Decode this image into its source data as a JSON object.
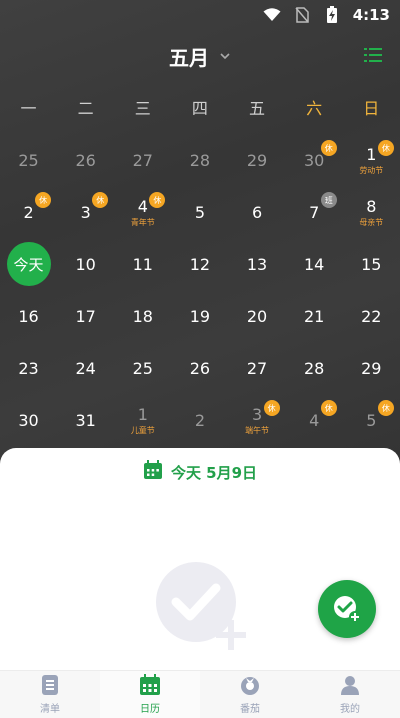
{
  "status_bar": {
    "time": "4:13"
  },
  "header": {
    "month": "五月"
  },
  "weekdays": [
    "一",
    "二",
    "三",
    "四",
    "五",
    "六",
    "日"
  ],
  "weeks": [
    [
      {
        "n": "25",
        "other": true
      },
      {
        "n": "26",
        "other": true
      },
      {
        "n": "27",
        "other": true
      },
      {
        "n": "28",
        "other": true
      },
      {
        "n": "29",
        "other": true
      },
      {
        "n": "30",
        "other": true,
        "badge": "休"
      },
      {
        "n": "1",
        "badge": "休",
        "fest": "劳动节"
      }
    ],
    [
      {
        "n": "2",
        "badge": "休"
      },
      {
        "n": "3",
        "badge": "休"
      },
      {
        "n": "4",
        "badge": "休",
        "fest": "青年节"
      },
      {
        "n": "5"
      },
      {
        "n": "6"
      },
      {
        "n": "7",
        "badge": "班",
        "work": true
      },
      {
        "n": "8",
        "fest": "母亲节"
      }
    ],
    [
      {
        "n": "今天",
        "today": true
      },
      {
        "n": "10"
      },
      {
        "n": "11"
      },
      {
        "n": "12"
      },
      {
        "n": "13"
      },
      {
        "n": "14"
      },
      {
        "n": "15"
      }
    ],
    [
      {
        "n": "16"
      },
      {
        "n": "17"
      },
      {
        "n": "18"
      },
      {
        "n": "19"
      },
      {
        "n": "20"
      },
      {
        "n": "21"
      },
      {
        "n": "22"
      }
    ],
    [
      {
        "n": "23"
      },
      {
        "n": "24"
      },
      {
        "n": "25"
      },
      {
        "n": "26"
      },
      {
        "n": "27"
      },
      {
        "n": "28"
      },
      {
        "n": "29"
      }
    ],
    [
      {
        "n": "30"
      },
      {
        "n": "31"
      },
      {
        "n": "1",
        "other": true,
        "fest": "儿童节"
      },
      {
        "n": "2",
        "other": true
      },
      {
        "n": "3",
        "other": true,
        "badge": "休",
        "fest": "端午节"
      },
      {
        "n": "4",
        "other": true,
        "badge": "休"
      },
      {
        "n": "5",
        "other": true,
        "badge": "休"
      }
    ]
  ],
  "sheet": {
    "title": "今天 5月9日"
  },
  "nav": [
    {
      "label": "清单",
      "icon": "checklist-icon"
    },
    {
      "label": "日历",
      "icon": "calendar-icon",
      "active": true
    },
    {
      "label": "番茄",
      "icon": "tomato-icon"
    },
    {
      "label": "我的",
      "icon": "profile-icon"
    }
  ],
  "colors": {
    "accent": "#22b04b",
    "holiday": "#f5a623",
    "festival": "#f0a33c"
  }
}
